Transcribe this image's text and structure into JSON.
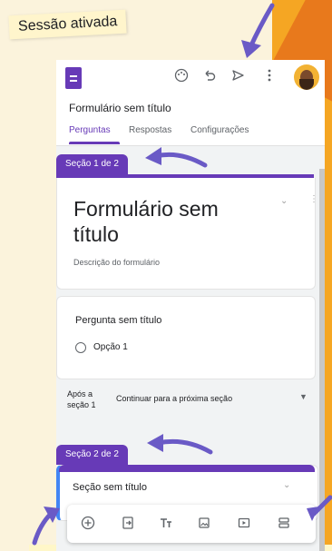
{
  "caption": "Sessão ativada",
  "form": {
    "app_title": "Formulário sem título",
    "tabs": [
      "Perguntas",
      "Respostas",
      "Configurações"
    ],
    "section1_badge": "Seção 1 de 2",
    "title": "Formulário sem título",
    "description": "Descrição do formulário",
    "question": "Pergunta sem título",
    "option1": "Opção 1",
    "after_section_label": "Após a seção 1",
    "after_section_value": "Continuar para a próxima seção",
    "section2_badge": "Seção 2 de 2",
    "section2_title": "Seção sem título"
  },
  "icons": {
    "palette": "palette-icon",
    "undo": "undo-icon",
    "send": "send-icon",
    "more": "more-vert-icon",
    "add": "add-question-icon",
    "import": "import-questions-icon",
    "title": "add-title-icon",
    "image": "add-image-icon",
    "video": "add-video-icon",
    "section": "add-section-icon"
  },
  "colors": {
    "accent": "#673ab7",
    "background": "#fbf3dc",
    "orange": "#f5a623",
    "arrow": "#6a5ac6"
  }
}
